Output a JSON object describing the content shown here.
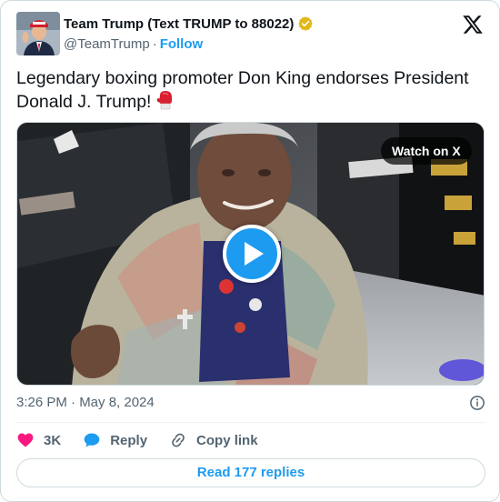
{
  "author": {
    "name": "Team Trump (Text TRUMP to 88022)",
    "handle": "@TeamTrump",
    "separator": "·",
    "follow_label": "Follow",
    "verified_color": "#e2b719"
  },
  "tweet": {
    "text": "Legendary boxing promoter Don King endorses President Donald J. Trump!",
    "emoji_name": "boxing-glove-icon"
  },
  "media": {
    "watch_label": "Watch on X",
    "play_icon": "play-icon"
  },
  "meta": {
    "timestamp": "3:26 PM · May 8, 2024",
    "info_icon": "info-icon"
  },
  "actions": {
    "like_count": "3K",
    "reply_label": "Reply",
    "copy_label": "Copy link"
  },
  "replies_button": {
    "label": "Read 177 replies"
  },
  "colors": {
    "accent": "#1d9bf0",
    "like": "#f91880",
    "muted": "#536471"
  }
}
